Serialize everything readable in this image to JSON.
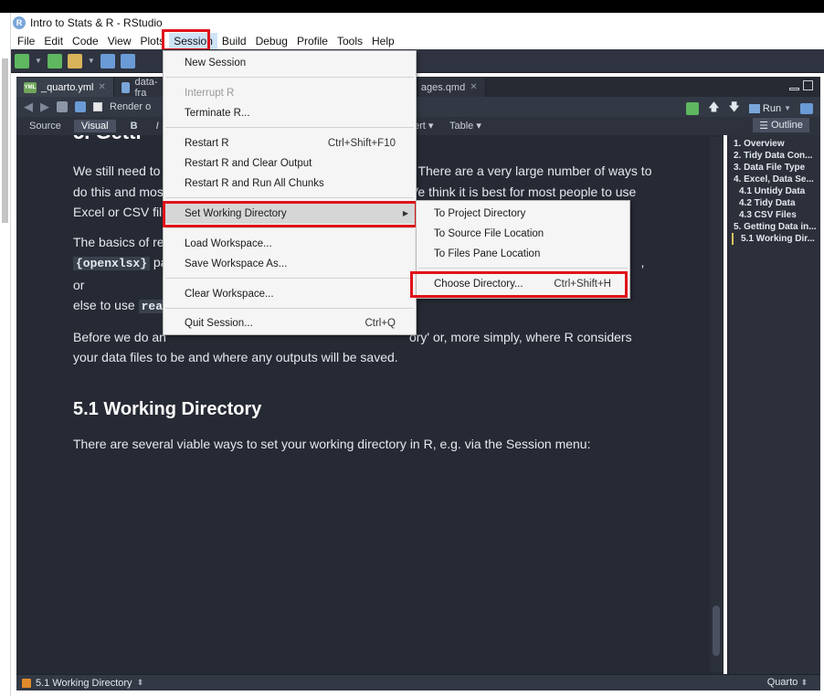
{
  "window": {
    "title": "Intro to Stats & R - RStudio",
    "logo_letter": "R"
  },
  "menubar": [
    "File",
    "Edit",
    "Code",
    "View",
    "Plots",
    "Session",
    "Build",
    "Debug",
    "Profile",
    "Tools",
    "Help"
  ],
  "tabs": [
    {
      "label": "_quarto.yml",
      "icon_text": "YML"
    },
    {
      "label": "data-fra",
      "truncated": true
    },
    {
      "label": "ages.qmd",
      "truncated": true
    }
  ],
  "editor_toolbar": {
    "render_label": "Render o",
    "run_label": "Run"
  },
  "visual_toolbar": {
    "source": "Source",
    "visual": "Visual",
    "bold": "B",
    "italic": "I",
    "insert": "ert",
    "table": "Table",
    "outline": "Outline"
  },
  "document": {
    "heading1_partial": "5. Getti",
    "para1_l1a": "We still need to",
    "para1_l1b": "There are a very large number of ways to",
    "para1_l2a": "do this and mos",
    "para1_l2b": "Ve think it is best for most people to use",
    "para1_l3a": "Excel or CSV files",
    "para2_l1a": "The basics of rea",
    "para2_code1": "{openxlsx}",
    "para2_l2a": "pa",
    "para2_l2b": ", or",
    "para2_l3a": "else to use",
    "para2_code2": "read",
    "para3_l1a": "Before we do an",
    "para3_l1b": "ory' or, more simply, where R considers",
    "para3_l2": "your data files to be and where any outputs will be saved.",
    "heading2": "5.1 Working Directory",
    "para4": "There are several viable ways to set your working directory in R, e.g. via the Session menu:"
  },
  "outline": [
    {
      "label": "1. Overview",
      "level": 1
    },
    {
      "label": "2. Tidy Data Con...",
      "level": 1
    },
    {
      "label": "3. Data File Type",
      "level": 1
    },
    {
      "label": "4. Excel, Data Se...",
      "level": 1
    },
    {
      "label": "4.1 Untidy Data",
      "level": 2
    },
    {
      "label": "4.2 Tidy Data",
      "level": 2
    },
    {
      "label": "4.3 CSV Files",
      "level": 2
    },
    {
      "label": "5. Getting Data in...",
      "level": 1
    },
    {
      "label": "5.1 Working Dir...",
      "level": 2,
      "current": true
    }
  ],
  "status": {
    "section": "5.1 Working Directory",
    "mode": "Quarto"
  },
  "session_menu": {
    "new_session": "New Session",
    "interrupt": "Interrupt R",
    "terminate": "Terminate R...",
    "restart": "Restart R",
    "restart_sc": "Ctrl+Shift+F10",
    "restart_clear": "Restart R and Clear Output",
    "restart_run": "Restart R and Run All Chunks",
    "set_wd": "Set Working Directory",
    "load_ws": "Load Workspace...",
    "save_ws": "Save Workspace As...",
    "clear_ws": "Clear Workspace...",
    "quit": "Quit Session...",
    "quit_sc": "Ctrl+Q"
  },
  "wd_submenu": {
    "project": "To Project Directory",
    "source": "To Source File Location",
    "files": "To Files Pane Location",
    "choose": "Choose Directory...",
    "choose_sc": "Ctrl+Shift+H"
  },
  "colors": {
    "highlight_box": "#e0131a",
    "editor_bg": "#262a34",
    "menu_bg": "#f5f5f5"
  }
}
